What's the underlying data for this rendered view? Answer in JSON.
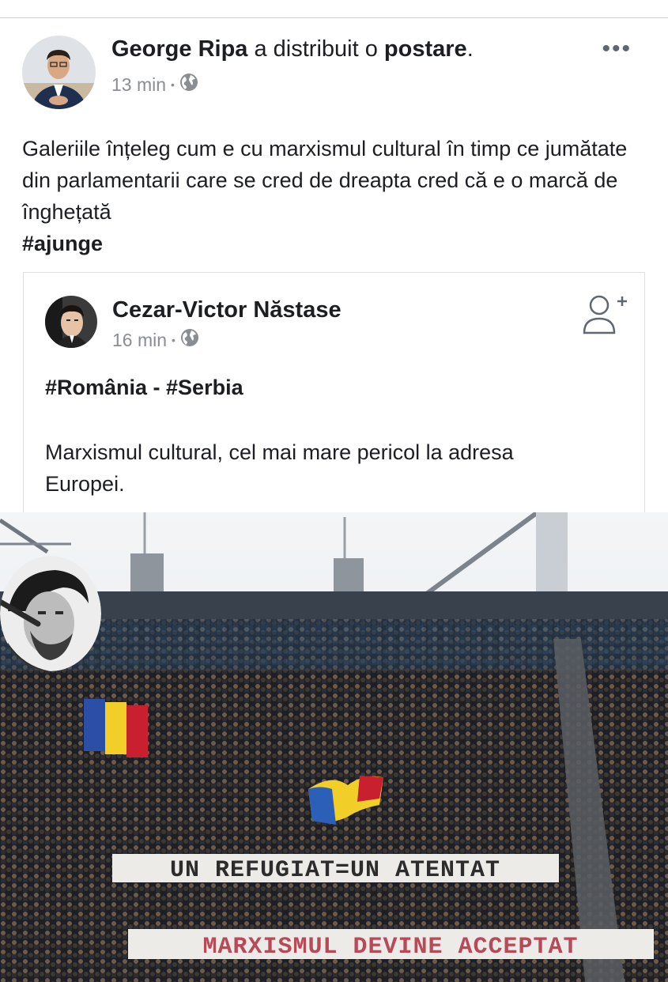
{
  "post": {
    "author": "George Ripa",
    "action_prefix": " a distribuit o ",
    "action_object": "postare",
    "action_suffix": ".",
    "time": "13 min",
    "more_label": "•••",
    "text": "Galeriile înțeleg cum e cu marxismul cultural în timp ce jumătate din parlamentarii care se cred de dreapta cred că e o marcă de înghețată",
    "hashtag": "#ajunge"
  },
  "shared_post": {
    "author": "Cezar-Victor Năstase",
    "time": "16 min",
    "tags": "#România - #Serbia",
    "text": "Marxismul cultural, cel mai mare pericol la adresa Europei."
  },
  "photo": {
    "banner_top": "UN REFUGIAT=UN ATENTAT",
    "banner_bottom": "MARXISMUL DEVINE ACCEPTAT"
  },
  "colors": {
    "meta_gray": "#8a8d91",
    "text": "#1c1e21",
    "border": "#dddfe2"
  },
  "icons": [
    "globe-icon",
    "more-icon",
    "add-friend-icon"
  ]
}
